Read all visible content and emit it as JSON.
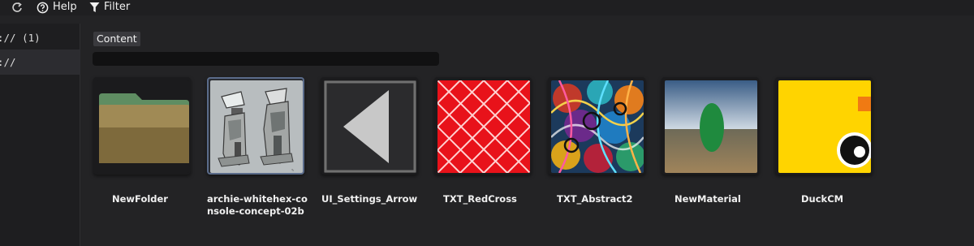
{
  "toolbar": {
    "redo_icon": "redo-icon",
    "help_label": "Help",
    "filter_label": "Filter"
  },
  "sidebar": {
    "items": [
      {
        "label": ":// (1)"
      },
      {
        "label": "://"
      }
    ]
  },
  "main": {
    "content_label": "Content",
    "search_value": "",
    "assets": [
      {
        "name": "NewFolder",
        "type": "folder"
      },
      {
        "name": "archie-whitehex-console-concept-02b",
        "type": "image",
        "selected": true
      },
      {
        "name": "UI_Settings_Arrow",
        "type": "texture"
      },
      {
        "name": "TXT_RedCross",
        "type": "texture"
      },
      {
        "name": "TXT_Abstract2",
        "type": "texture"
      },
      {
        "name": "NewMaterial",
        "type": "material"
      },
      {
        "name": "DuckCM",
        "type": "cubemap"
      }
    ]
  },
  "colors": {
    "background": "#232325",
    "selection": "#5a6b8a",
    "red_cross": "#e8121a",
    "duck_yellow": "#ffd400"
  }
}
